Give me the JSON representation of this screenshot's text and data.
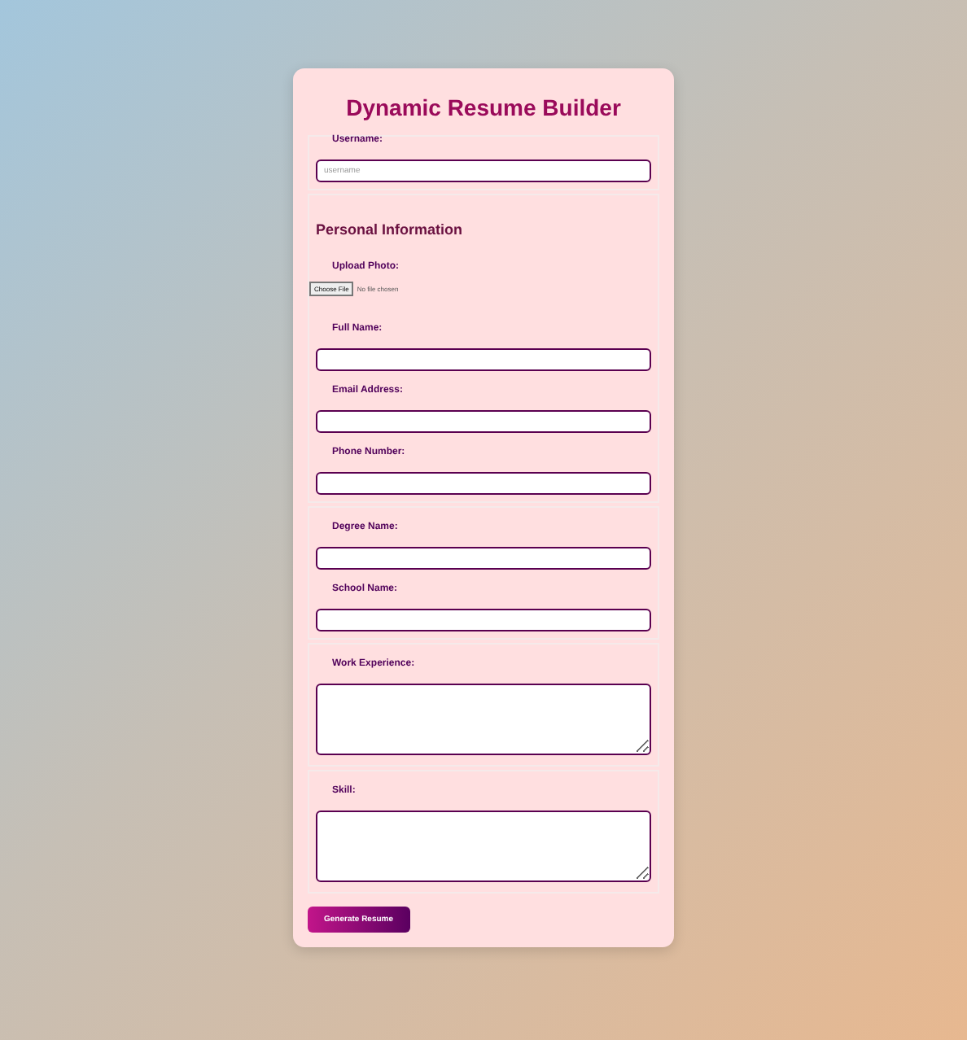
{
  "title": "Dynamic Resume Builder",
  "sections": [
    {
      "fields": [
        {
          "kind": "text",
          "label": "Username:",
          "placeholder": "username"
        }
      ]
    },
    {
      "heading": "Personal Information",
      "fields": [
        {
          "kind": "file",
          "label": "Upload Photo:",
          "button": "Choose File",
          "status": "No file chosen"
        },
        {
          "kind": "text",
          "label": "Full Name:"
        },
        {
          "kind": "text",
          "label": "Email Address:"
        },
        {
          "kind": "text",
          "label": "Phone Number:"
        }
      ]
    },
    {
      "fields": [
        {
          "kind": "text",
          "label": "Degree Name:"
        },
        {
          "kind": "text",
          "label": "School Name:"
        }
      ]
    },
    {
      "fields": [
        {
          "kind": "textarea",
          "label": "Work Experience:"
        }
      ]
    },
    {
      "fields": [
        {
          "kind": "textarea",
          "label": "Skill:"
        }
      ]
    }
  ],
  "submit": "Generate Resume"
}
